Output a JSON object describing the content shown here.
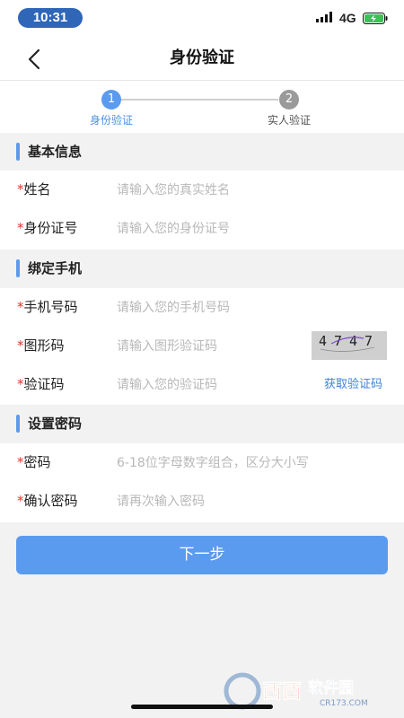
{
  "status_bar": {
    "time": "10:31",
    "network": "4G"
  },
  "nav": {
    "title": "身份验证",
    "back_icon": "chevron-left-icon"
  },
  "stepper": {
    "steps": [
      {
        "number": "1",
        "label": "身份验证",
        "state": "active"
      },
      {
        "number": "2",
        "label": "实人验证",
        "state": "inactive"
      }
    ],
    "active_color": "#5b9bef",
    "inactive_color": "#9a9a9a"
  },
  "sections": {
    "basic": {
      "title": "基本信息",
      "fields": [
        {
          "required": "*",
          "label": "姓名",
          "placeholder": "请输入您的真实姓名",
          "value": ""
        },
        {
          "required": "*",
          "label": "身份证号",
          "placeholder": "请输入您的身份证号",
          "value": ""
        }
      ]
    },
    "phone": {
      "title": "绑定手机",
      "fields": [
        {
          "required": "*",
          "label": "手机号码",
          "placeholder": "请输入您的手机号码",
          "value": ""
        },
        {
          "required": "*",
          "label": "图形码",
          "placeholder": "请输入图形验证码",
          "value": ""
        },
        {
          "required": "*",
          "label": "验证码",
          "placeholder": "请输入您的验证码",
          "value": ""
        }
      ],
      "captcha_text": "4747",
      "sms_button": "获取验证码"
    },
    "password": {
      "title": "设置密码",
      "fields": [
        {
          "required": "*",
          "label": "密码",
          "placeholder": "6-18位字母数字组合，区分大小写",
          "value": ""
        },
        {
          "required": "*",
          "label": "确认密码",
          "placeholder": "请再次输入密码",
          "value": ""
        }
      ]
    }
  },
  "actions": {
    "next_label": "下一步"
  },
  "watermark": {
    "text": "西西软件园",
    "subtext": "CR173.COM"
  },
  "colors": {
    "accent": "#5b9bef",
    "required": "#e0352b",
    "link": "#3a82e0",
    "placeholder": "#b8b8b8"
  }
}
